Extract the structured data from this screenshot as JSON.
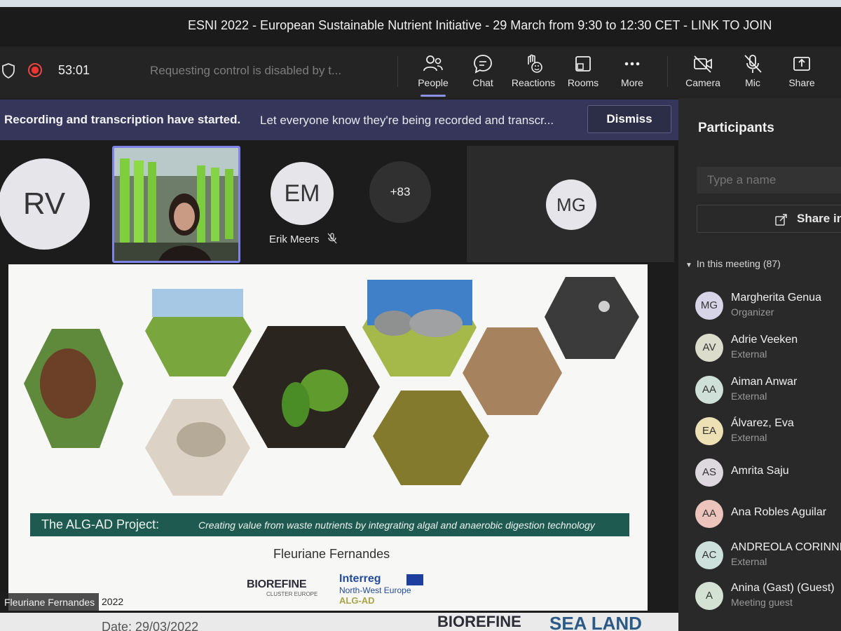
{
  "window": {
    "title": "ESNI 2022 - European Sustainable Nutrient Initiative - 29 March from 9:30 to 12:30 CET - LINK TO JOIN"
  },
  "toolbar": {
    "timer": "53:01",
    "control_status": "Requesting control is disabled by t...",
    "buttons": [
      {
        "label": "People",
        "icon": "people-icon",
        "active": true
      },
      {
        "label": "Chat",
        "icon": "chat-icon"
      },
      {
        "label": "Reactions",
        "icon": "reactions-icon"
      },
      {
        "label": "Rooms",
        "icon": "rooms-icon"
      },
      {
        "label": "More",
        "icon": "more-icon"
      },
      {
        "label": "Camera",
        "icon": "camera-off-icon"
      },
      {
        "label": "Mic",
        "icon": "mic-off-icon"
      },
      {
        "label": "Share",
        "icon": "share-icon"
      }
    ]
  },
  "notice": {
    "title": "Recording and transcription have started.",
    "message": "Let everyone know they're being recorded and transcr...",
    "dismiss_label": "Dismiss"
  },
  "gallery": {
    "tiles": [
      {
        "initials": "RV"
      },
      {
        "initials": "EM",
        "name": "Erik Meers",
        "muted": true
      },
      {
        "overflow": "+83"
      },
      {
        "initials": "MG"
      }
    ]
  },
  "slide": {
    "banner_title": "The ALG-AD Project:",
    "banner_subtitle": "Creating value from waste nutrients by integrating algal and anaerobic digestion technology",
    "presenter": "Fleuriane Fernandes",
    "logo_biorefine": "BIOREFINE",
    "logo_biorefine_sub": "CLUSTER EUROPE",
    "logo_interreg": "Interreg",
    "logo_interreg_region": "North-West Europe",
    "logo_interreg_project": "ALG-AD"
  },
  "caption": {
    "name": "Fleuriane Fernandes",
    "year": "2022"
  },
  "peek": {
    "left": "Date: 29/03/2022",
    "biorefine": "BIOREFINE",
    "sealand": "SEA LAND"
  },
  "panel": {
    "title": "Participants",
    "search_placeholder": "Type a name",
    "share_label": "Share in",
    "section": "In this meeting (87)",
    "participants": [
      {
        "initials": "MG",
        "name": "Margherita Genua",
        "role": "Organizer",
        "color": "#d8d4e8"
      },
      {
        "initials": "AV",
        "name": "Adrie Veeken",
        "role": "External",
        "color": "#dcdccc"
      },
      {
        "initials": "AA",
        "name": "Aiman Anwar",
        "role": "External",
        "color": "#cfe0d8"
      },
      {
        "initials": "EA",
        "name": "Álvarez, Eva",
        "role": "External",
        "color": "#ece0b4"
      },
      {
        "initials": "AS",
        "name": "Amrita Saju",
        "role": "",
        "color": "#ddd8de"
      },
      {
        "initials": "AA",
        "name": "Ana Robles Aguilar",
        "role": "",
        "color": "#ecc4bc"
      },
      {
        "initials": "AC",
        "name": "ANDREOLA CORINNE",
        "role": "External",
        "color": "#cde0dc"
      },
      {
        "initials": "A",
        "name": "Anina (Gast) (Guest)",
        "role": "Meeting guest",
        "color": "#d4e2d4"
      }
    ]
  }
}
